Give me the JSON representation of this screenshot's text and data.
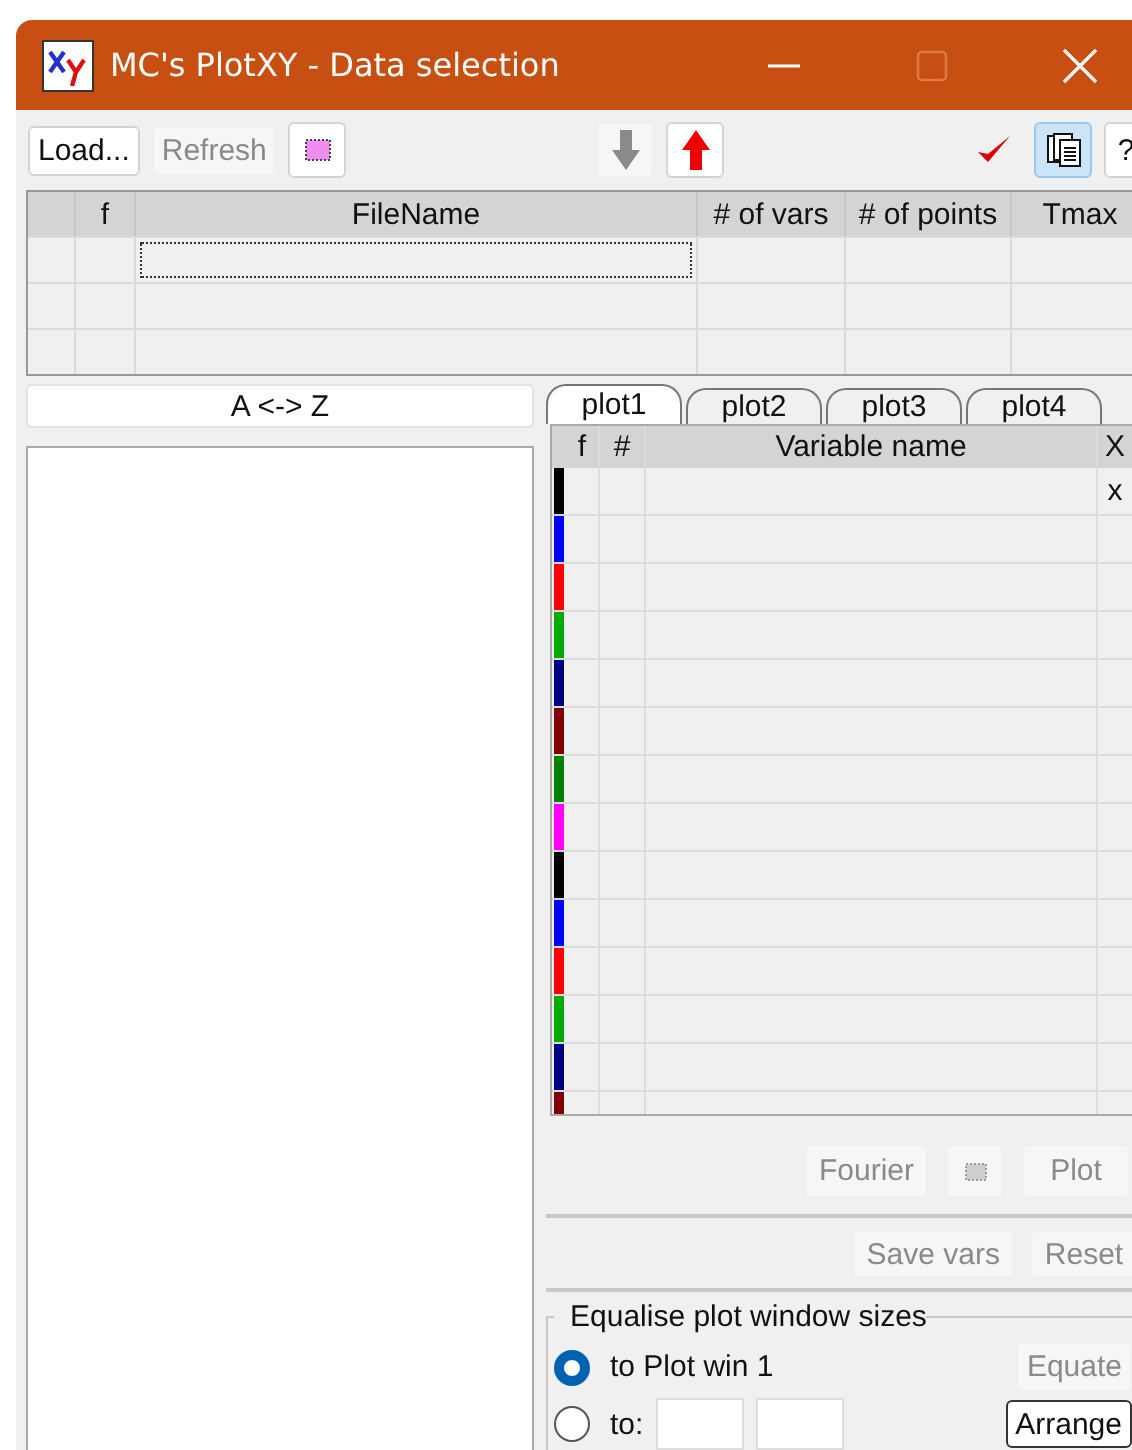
{
  "window": {
    "title": "MC's PlotXY - Data selection"
  },
  "toolbar": {
    "load": {
      "label": "Load...",
      "disabled": false
    },
    "refresh": {
      "label": "Refresh",
      "disabled": true
    },
    "down_disabled": true,
    "up_disabled": false,
    "copy_pressed": true,
    "help": {
      "label": "?"
    }
  },
  "file_table": {
    "columns": [
      "f",
      "FileName",
      "# of vars",
      "# of points",
      "Tmax"
    ]
  },
  "sort_button": {
    "label": "A <-> Z"
  },
  "tabs": [
    {
      "label": "plot1",
      "selected": true
    },
    {
      "label": "plot2",
      "selected": false
    },
    {
      "label": "plot3",
      "selected": false
    },
    {
      "label": "plot4",
      "selected": false
    }
  ],
  "variables": {
    "columns": [
      "f",
      "#",
      "Variable name",
      "X"
    ],
    "rows": [
      {
        "color": "#000000",
        "x": "x"
      },
      {
        "color": "#0000ff"
      },
      {
        "color": "#ff0000"
      },
      {
        "color": "#00aa00"
      },
      {
        "color": "#000080"
      },
      {
        "color": "#800000"
      },
      {
        "color": "#008000"
      },
      {
        "color": "#ff00ff"
      },
      {
        "color": "#000000"
      },
      {
        "color": "#0000ff"
      },
      {
        "color": "#ff0000"
      },
      {
        "color": "#00aa00"
      },
      {
        "color": "#000080"
      },
      {
        "color": "#800000"
      }
    ]
  },
  "plot_buttons": [
    {
      "kind": "text",
      "label": "Fourier",
      "disabled": true
    },
    {
      "kind": "swatch",
      "disabled": true
    },
    {
      "kind": "text",
      "label": "Plot",
      "disabled": true
    }
  ],
  "var_buttons": [
    {
      "label": "Save vars",
      "disabled": true
    },
    {
      "label": "Reset",
      "disabled": true
    }
  ],
  "equalise": {
    "title": "Equalise plot window sizes",
    "options": [
      {
        "label": "to Plot win 1",
        "selected": true
      },
      {
        "label": "to:",
        "selected": false
      }
    ],
    "equate": {
      "label": "Equate",
      "disabled": true
    },
    "arrange": {
      "label": "Arrange",
      "disabled": false
    }
  }
}
